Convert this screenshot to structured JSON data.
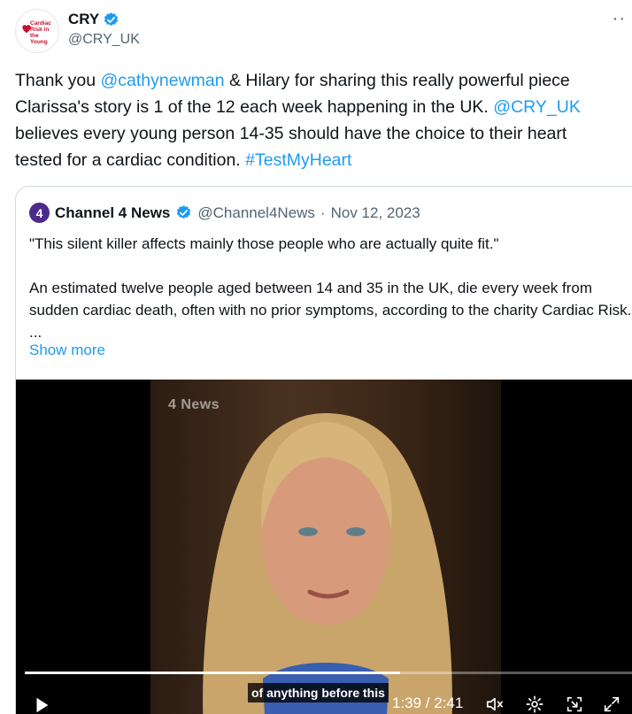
{
  "author": {
    "display_name": "CRY",
    "handle": "@CRY_UK",
    "avatar_lines": [
      "Cardiac",
      "Risk in the",
      "Young"
    ],
    "verified_icon": "verified-badge-icon",
    "more_label": "··"
  },
  "tweet": {
    "t1": "Thank you ",
    "m1": "@cathynewman",
    "t2": " & Hilary for sharing this really powerful piece\nClarissa's story is 1 of the 12 each week happening in the UK. ",
    "m2": "@CRY_UK",
    "t3": "\nbelieves every young person 14-35 should have the choice to their heart\ntested for a cardiac condition. ",
    "tag": "#TestMyHeart"
  },
  "quote": {
    "avatar_glyph": "4",
    "name": "Channel 4 News",
    "handle": "@Channel4News",
    "separator": "·",
    "date": "Nov 12, 2023",
    "para1": "\"This silent killer affects mainly those people who are actually quite fit.\"",
    "para2": "An estimated twelve people aged between 14 and 35 in the UK, die every week from sudden cardiac death, often with no prior symptoms, according to the charity Cardiac Risk. ...",
    "show_more": "Show more"
  },
  "video": {
    "watermark": "4 News",
    "subtitle": "of anything before this",
    "time": "1:39 / 2:41",
    "progress_fraction": 0.615,
    "icons": [
      "play-icon",
      "mute-icon",
      "settings-icon",
      "pip-icon",
      "fullscreen-icon"
    ]
  },
  "colors": {
    "link": "#1d9bf0",
    "text": "#0f1419",
    "muted": "#536471",
    "brand_red": "#c8102e",
    "channel4_purple": "#4b2a8a"
  }
}
